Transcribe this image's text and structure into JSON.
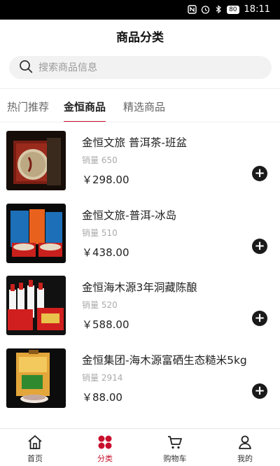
{
  "status_bar": {
    "time": "18:11",
    "battery": "80"
  },
  "header": {
    "title": "商品分类"
  },
  "search": {
    "placeholder": "搜索商品信息"
  },
  "tabs": [
    {
      "label": "热门推荐",
      "active": false
    },
    {
      "label": "金恒商品",
      "active": true
    },
    {
      "label": "精选商品",
      "active": false
    }
  ],
  "products": [
    {
      "name": "金恒文旅 普洱茶-班盆",
      "sales": "销量 650",
      "price": "￥298.00"
    },
    {
      "name": "金恒文旅-普洱-冰岛",
      "sales": "销量 510",
      "price": "￥438.00"
    },
    {
      "name": "金恒海木源3年洞藏陈酿",
      "sales": "销量 520",
      "price": "￥588.00"
    },
    {
      "name": "金恒集团-海木源富硒生态糙米5kg",
      "sales": "销量 2914",
      "price": "￥88.00"
    }
  ],
  "add_button_symbol": "+",
  "nav": [
    {
      "label": "首页",
      "icon": "home-icon",
      "active": false
    },
    {
      "label": "分类",
      "icon": "category-icon",
      "active": true
    },
    {
      "label": "购物车",
      "icon": "cart-icon",
      "active": false
    },
    {
      "label": "我的",
      "icon": "profile-icon",
      "active": false
    }
  ],
  "colors": {
    "accent": "#c8102e",
    "status_bar": "#000000",
    "search_bg": "#f2f2f2"
  }
}
